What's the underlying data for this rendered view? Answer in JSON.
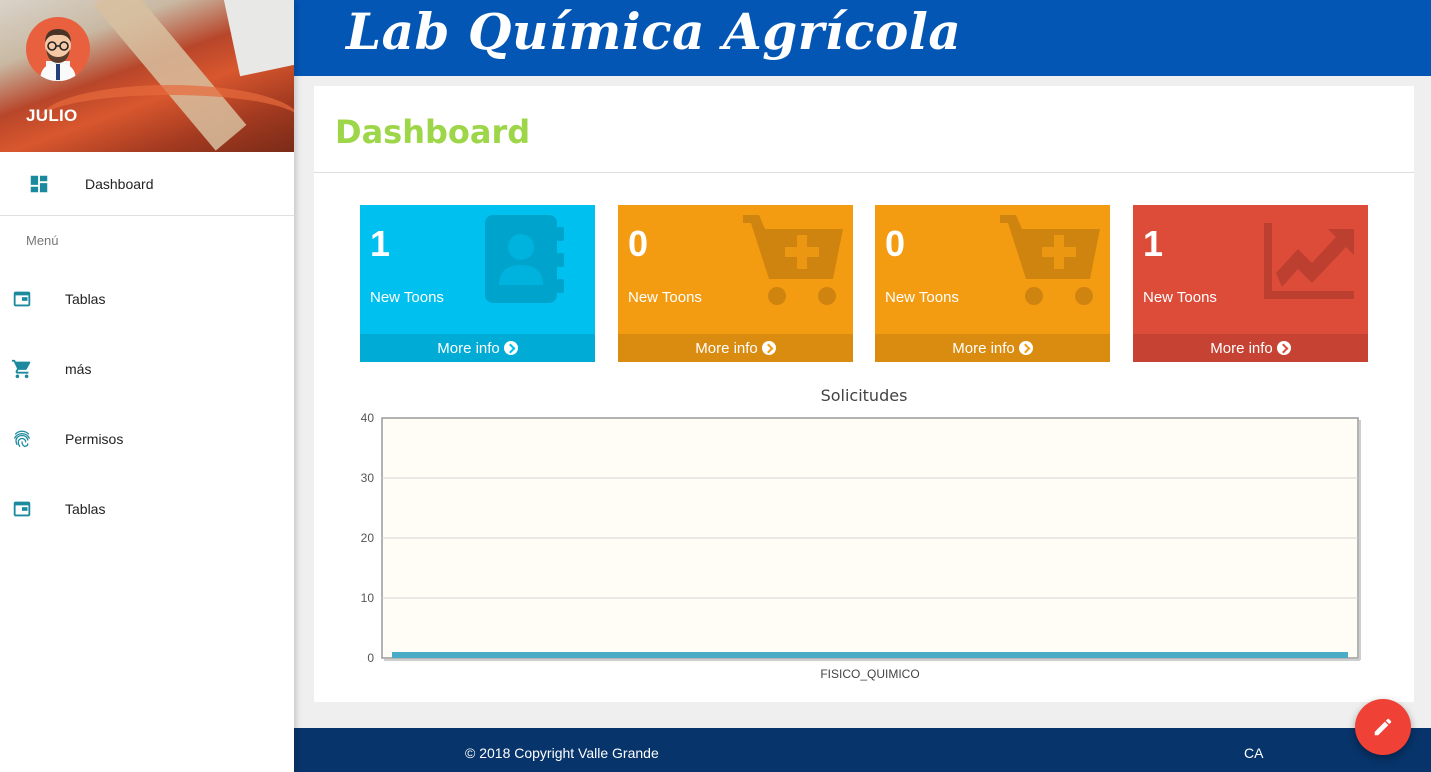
{
  "app": {
    "brand": "Lab Química Agrícola"
  },
  "user": {
    "name": "JULIO"
  },
  "sidebar": {
    "top_item": {
      "label": "Dashboard",
      "icon": "dashboard-icon"
    },
    "section_label": "Menú",
    "items": [
      {
        "label": "Tablas",
        "icon": "web-asset-icon"
      },
      {
        "label": "más",
        "icon": "cart-icon"
      },
      {
        "label": "Permisos",
        "icon": "fingerprint-icon"
      },
      {
        "label": "Tablas",
        "icon": "web-asset-icon"
      }
    ]
  },
  "page": {
    "title": "Dashboard"
  },
  "stat_boxes": [
    {
      "value": "1",
      "label": "New Toons",
      "link": "More info",
      "color": "#00c0ef",
      "icon": "contacts-book-icon"
    },
    {
      "value": "0",
      "label": "New Toons",
      "link": "More info",
      "color": "#f39c12",
      "icon": "cart-plus-icon"
    },
    {
      "value": "0",
      "label": "New Toons",
      "link": "More info",
      "color": "#f39c12",
      "icon": "cart-plus-icon"
    },
    {
      "value": "1",
      "label": "New Toons",
      "link": "More info",
      "color": "#dd4b39",
      "icon": "trending-up-icon"
    }
  ],
  "chart_data": {
    "type": "bar",
    "title": "Solicitudes",
    "categories": [
      "FISICO_QUIMICO"
    ],
    "values": [
      1
    ],
    "ylim": [
      0,
      40
    ],
    "yticks": [
      0,
      10,
      20,
      30,
      40
    ],
    "grid": true,
    "bar_color": "#4bacc6",
    "plot_background": "#fffdf5"
  },
  "footer": {
    "copyright": "© 2018 Copyright Valle Grande",
    "right_text": "CA"
  },
  "fab": {
    "icon": "pencil-icon"
  },
  "colors": {
    "header": "#0356b4",
    "footer": "#07346a",
    "title": "#9ed64a",
    "sidebar_icon": "#1b8a9e",
    "fab": "#ef4136"
  }
}
